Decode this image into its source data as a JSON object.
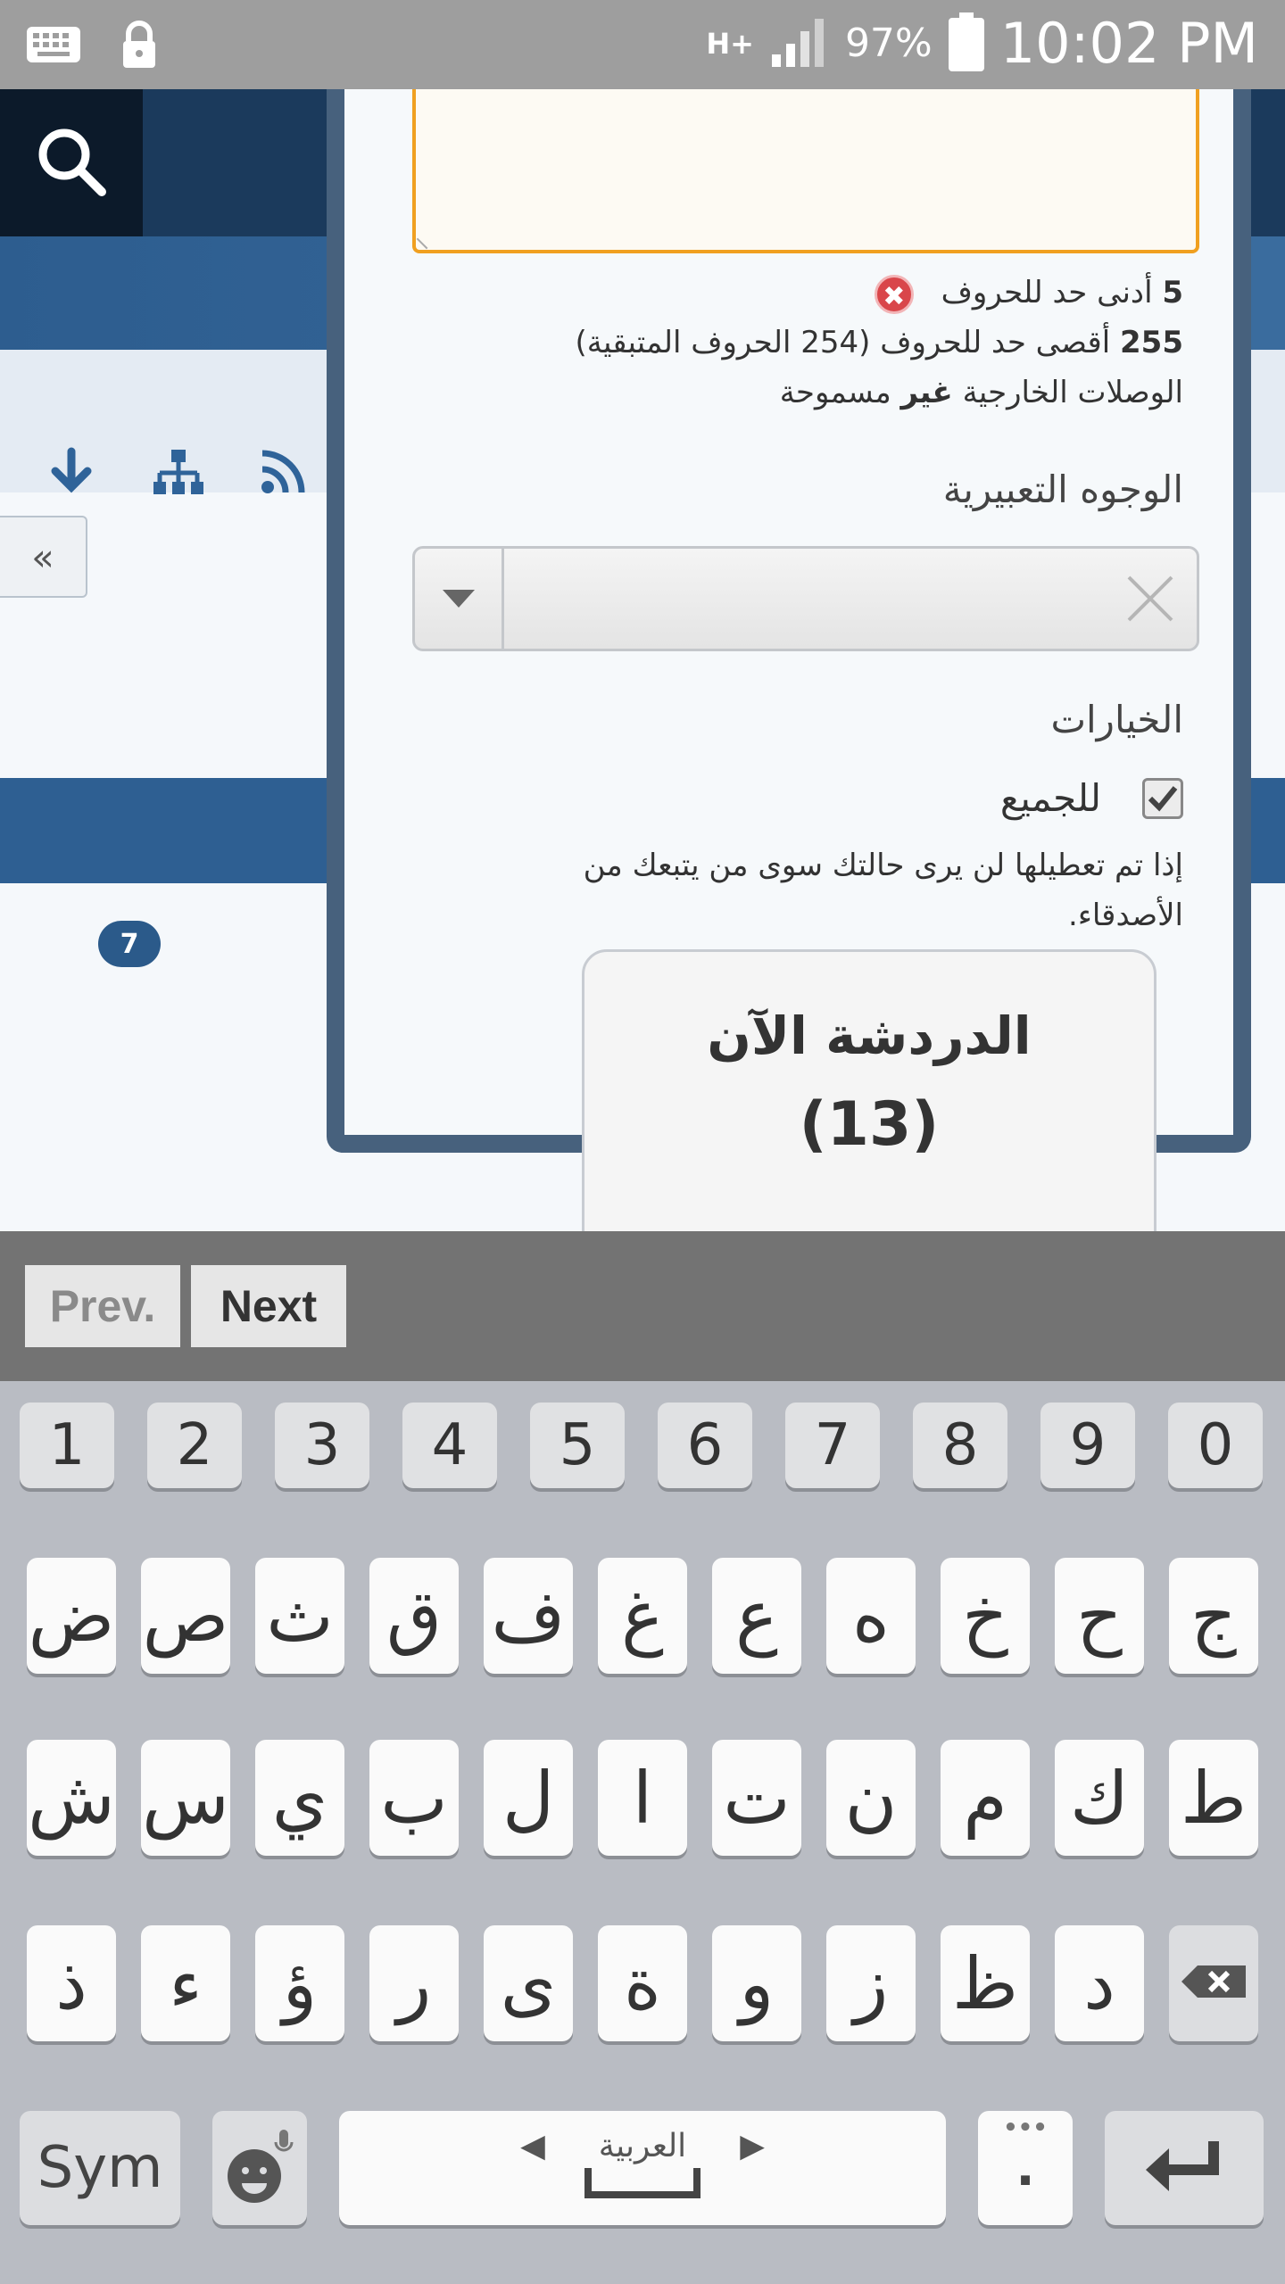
{
  "status_bar": {
    "network": "H+",
    "battery": "97%",
    "time": "10:02 PM"
  },
  "background": {
    "badge_count": "7",
    "collapse_label": "«"
  },
  "modal": {
    "limits": {
      "min_number": "5",
      "min_text": "أدنى حد للحروف",
      "max_number": "255",
      "max_text": "أقصى حد للحروف (254 الحروف المتبقية)",
      "links_prefix": "الوصلات الخارجية",
      "links_bold": "غير",
      "links_suffix": "مسموحة"
    },
    "emotions_label": "الوجوه التعبيرية",
    "options_label": "الخيارات",
    "everyone_label": "للجميع",
    "everyone_checked": true,
    "everyone_desc": "إذا تم تعطيلها لن يرى حالتك سوى من يتبعك من الأصدقاء."
  },
  "chat": {
    "title": "الدردشة الآن",
    "count": "(13)"
  },
  "keyboard_nav": {
    "prev": "Prev.",
    "next": "Next"
  },
  "keyboard": {
    "numbers": [
      "1",
      "2",
      "3",
      "4",
      "5",
      "6",
      "7",
      "8",
      "9",
      "0"
    ],
    "row1": [
      "ض",
      "ص",
      "ث",
      "ق",
      "ف",
      "غ",
      "ع",
      "ه",
      "خ",
      "ح",
      "ج"
    ],
    "row2": [
      "ش",
      "س",
      "ي",
      "ب",
      "ل",
      "ا",
      "ت",
      "ن",
      "م",
      "ك",
      "ط"
    ],
    "row3": [
      "ذ",
      "ء",
      "ؤ",
      "ر",
      "ى",
      "ة",
      "و",
      "ز",
      "ظ",
      "د"
    ],
    "sym": "Sym",
    "language": "العربية",
    "period": "."
  }
}
